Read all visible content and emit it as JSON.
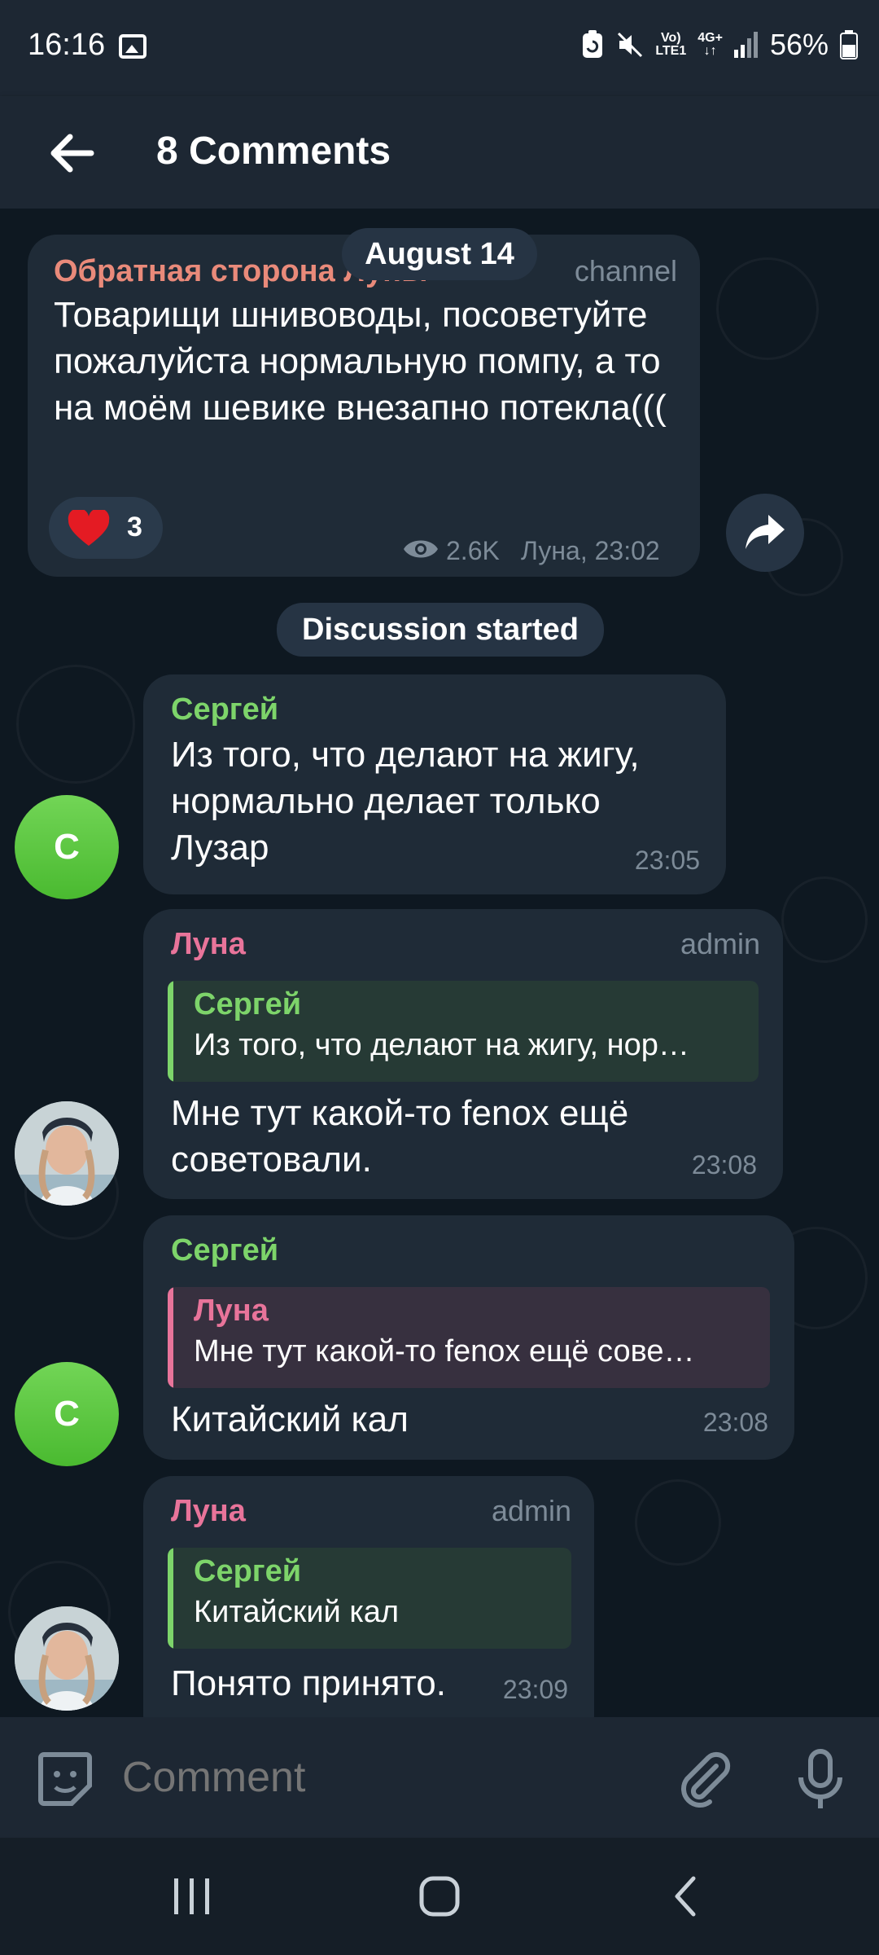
{
  "status_bar": {
    "time": "16:16",
    "battery": "56%",
    "network_top": "Vo)",
    "network_bottom": "LTE1",
    "network_gen": "4G+"
  },
  "header": {
    "title": "8 Comments"
  },
  "date_pill": "August 14",
  "channel_post": {
    "author": "Обратная сторона Луны",
    "tag": "channel",
    "text": "Товарищи шнивоводы, посоветуйте пожалуйста нормальную помпу, а то на моём шевике внезапно потекла(((",
    "reaction_count": "3",
    "views": "2.6K",
    "signature": "Луна, 23:02"
  },
  "discussion_pill": "Discussion started",
  "messages": [
    {
      "author": "Сергей",
      "avatar_letter": "С",
      "text": "Из того, что делают на жигу, нормально делает только Лузар",
      "time": "23:05"
    },
    {
      "author": "Луна",
      "role": "admin",
      "reply_author": "Сергей",
      "reply_text": "Из того, что делают на жигу, нор…",
      "text": "Мне тут какой-то fenox  ещё советовали.",
      "time": "23:08"
    },
    {
      "author": "Сергей",
      "avatar_letter": "С",
      "reply_author": "Луна",
      "reply_text": "Мне тут какой-то fenox  ещё сове…",
      "text": "Китайский кал",
      "time": "23:08"
    },
    {
      "author": "Луна",
      "role": "admin",
      "reply_author": "Сергей",
      "reply_text": "Китайский кал",
      "text": "Понято принято.",
      "time": "23:09"
    }
  ],
  "input": {
    "placeholder": "Comment"
  },
  "colors": {
    "sergey_name": "#7dd46a",
    "luna_name": "#e8749a",
    "channel_name": "#e98a7a",
    "bubble": "#1f2b37",
    "secondary_text": "#7d8b98"
  },
  "icons": [
    "back-arrow-icon",
    "gallery-icon",
    "battery-saver-icon",
    "mute-icon",
    "signal-icon",
    "battery-icon",
    "heart-icon",
    "eye-icon",
    "share-icon",
    "sticker-icon",
    "attach-icon",
    "mic-icon",
    "recents-icon",
    "home-icon",
    "nav-back-icon"
  ]
}
